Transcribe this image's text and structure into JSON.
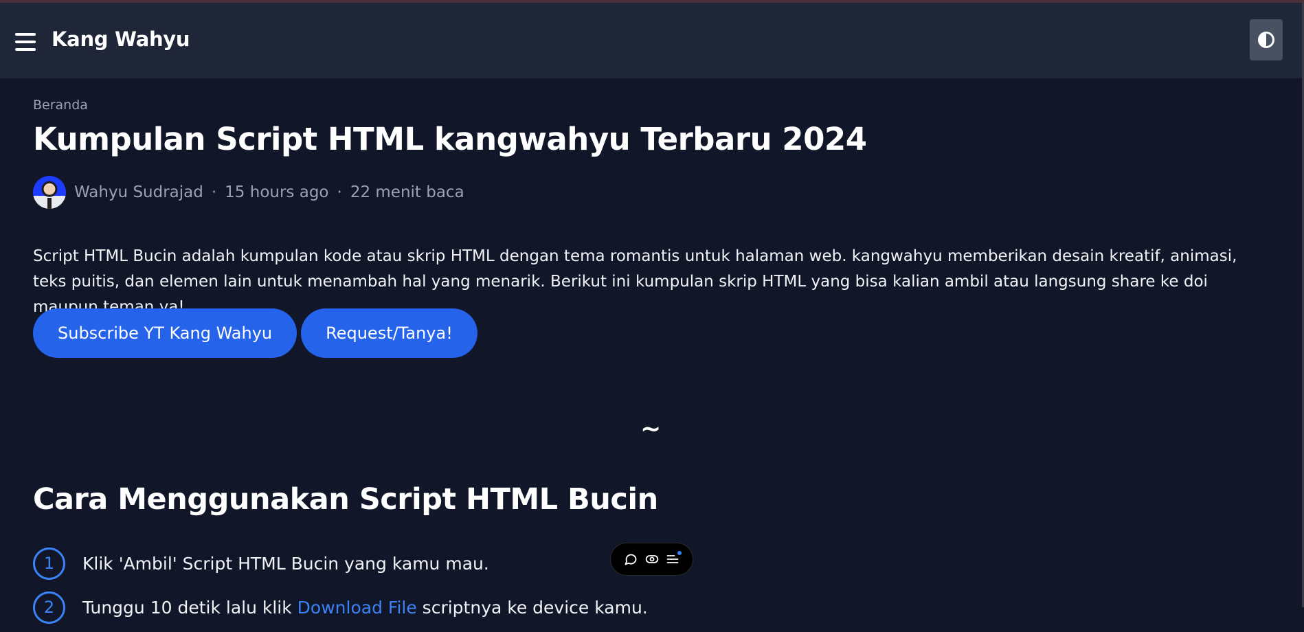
{
  "header": {
    "brand": "Kang Wahyu"
  },
  "breadcrumb": "Beranda",
  "article": {
    "title": "Kumpulan Script HTML kangwahyu Terbaru 2024",
    "author": "Wahyu Sudrajad",
    "time_ago": "15 hours ago",
    "read_time": "22 menit baca",
    "separator": "·",
    "description": "Script HTML Bucin adalah kumpulan kode atau skrip HTML dengan tema romantis untuk halaman web. kangwahyu memberikan desain kreatif, animasi, teks puitis, dan elemen lain untuk menambah hal yang menarik. Berikut ini kumpulan skrip HTML yang bisa kalian ambil atau langsung share ke doi maupun teman ya!",
    "buttons": {
      "subscribe": "Subscribe YT Kang Wahyu",
      "request": "Request/Tanya!"
    },
    "divider": "~",
    "section_title": "Cara Menggunakan Script HTML Bucin",
    "steps": [
      {
        "num": "1",
        "text": "Klik 'Ambil' Script HTML Bucin yang kamu mau."
      },
      {
        "num": "2",
        "text_before": "Tunggu 10 detik lalu klik ",
        "link": "Download File",
        "text_after": " scriptnya ke device kamu."
      }
    ]
  },
  "icons": {
    "menu": "menu-icon",
    "theme": "contrast-icon",
    "comment": "comment-icon",
    "view": "eye-icon",
    "toc": "list-icon"
  }
}
